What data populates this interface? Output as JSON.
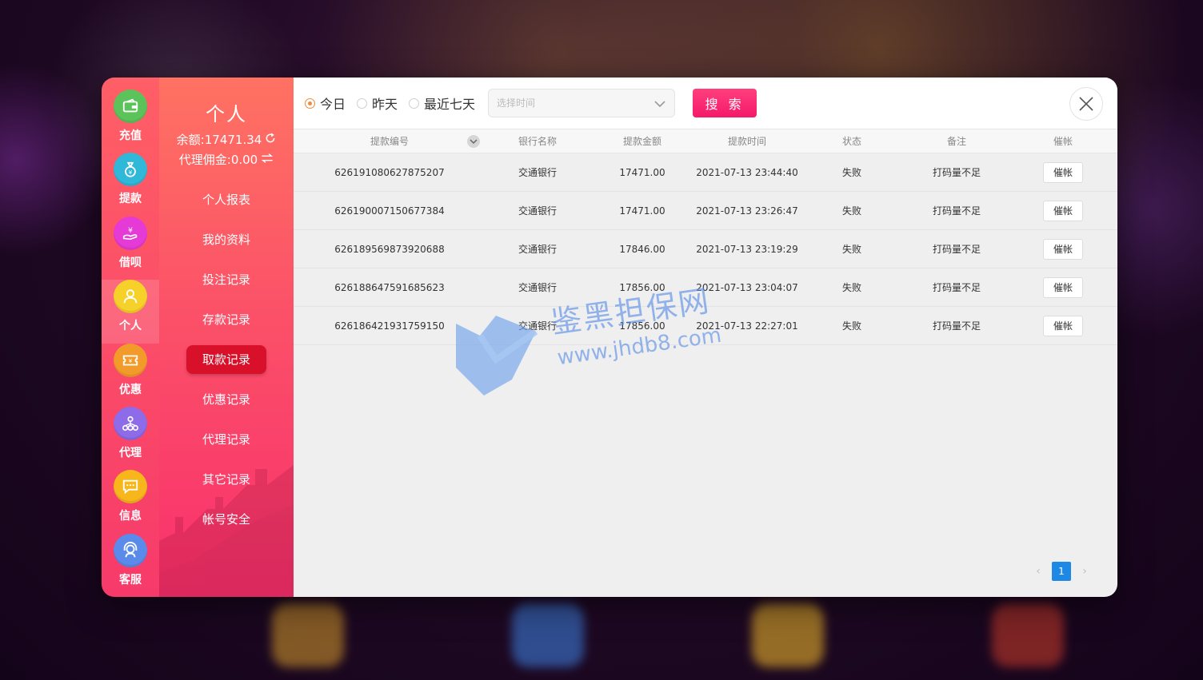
{
  "rail": {
    "items": [
      {
        "label": "充值",
        "icon": "wallet-icon",
        "color": "#5cc35a"
      },
      {
        "label": "提款",
        "icon": "money-bag-icon",
        "color": "#2fb8d8"
      },
      {
        "label": "借呗",
        "icon": "hand-coin-icon",
        "color": "#e63ad6"
      },
      {
        "label": "个人",
        "icon": "user-icon",
        "color": "#f6d12a"
      },
      {
        "label": "优惠",
        "icon": "ticket-icon",
        "color": "#f39b2a"
      },
      {
        "label": "代理",
        "icon": "network-icon",
        "color": "#8e6be8"
      },
      {
        "label": "信息",
        "icon": "message-icon",
        "color": "#f6b61c"
      },
      {
        "label": "客服",
        "icon": "headset-icon",
        "color": "#5a8bea"
      }
    ]
  },
  "submenu": {
    "title": "个人",
    "balance": "余额:17471.34",
    "commission": "代理佣金:0.00",
    "items": [
      "个人报表",
      "我的资料",
      "投注记录",
      "存款记录",
      "取款记录",
      "优惠记录",
      "代理记录",
      "其它记录",
      "帐号安全"
    ]
  },
  "filters": {
    "options": [
      "今日",
      "昨天",
      "最近七天"
    ],
    "selected": "今日",
    "date_placeholder": "选择时间",
    "search_label": "搜 索"
  },
  "table": {
    "columns": [
      "提款编号",
      "银行名称",
      "提款金额",
      "提款时间",
      "状态",
      "备注",
      "催帐"
    ],
    "rows": [
      {
        "id": "626191080627875207",
        "bank": "交通银行",
        "amount": "17471.00",
        "time": "2021-07-13 23:44:40",
        "status": "失败",
        "note": "打码量不足",
        "action": "催帐"
      },
      {
        "id": "626190007150677384",
        "bank": "交通银行",
        "amount": "17471.00",
        "time": "2021-07-13 23:26:47",
        "status": "失败",
        "note": "打码量不足",
        "action": "催帐"
      },
      {
        "id": "626189569873920688",
        "bank": "交通银行",
        "amount": "17846.00",
        "time": "2021-07-13 23:19:29",
        "status": "失败",
        "note": "打码量不足",
        "action": "催帐"
      },
      {
        "id": "626188647591685623",
        "bank": "交通银行",
        "amount": "17856.00",
        "time": "2021-07-13 23:04:07",
        "status": "失败",
        "note": "打码量不足",
        "action": "催帐"
      },
      {
        "id": "626186421931759150",
        "bank": "交通银行",
        "amount": "17856.00",
        "time": "2021-07-13 22:27:01",
        "status": "失败",
        "note": "打码量不足",
        "action": "催帐"
      }
    ]
  },
  "pagination": {
    "current": "1"
  },
  "watermark": {
    "cn": "鉴黑担保网",
    "url": "www.jhdb8.com"
  }
}
